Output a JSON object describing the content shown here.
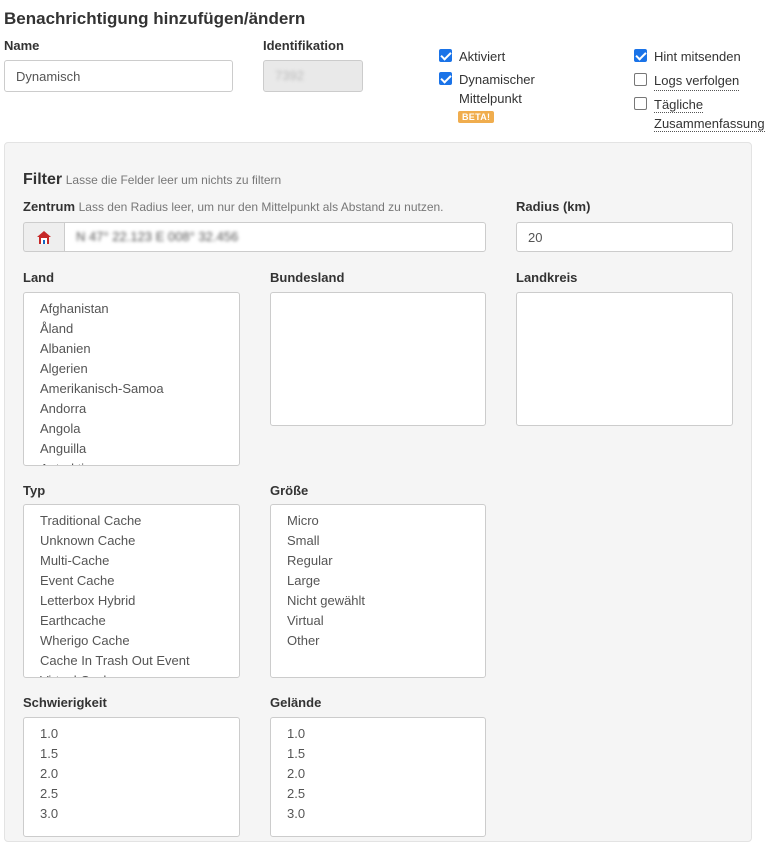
{
  "page_title": "Benachrichtigung hinzufügen/ändern",
  "name_field": {
    "label": "Name",
    "value": "Dynamisch"
  },
  "id_field": {
    "label": "Identifikation",
    "value": "7392"
  },
  "checkboxes": {
    "aktiviert": {
      "label": "Aktiviert",
      "checked": true
    },
    "dynamischer": {
      "label_line1": "Dynamischer",
      "label_line2": "Mittelpunkt",
      "checked": true,
      "badge": "BETA!"
    },
    "hint": {
      "label": "Hint mitsenden",
      "checked": true
    },
    "logs": {
      "label": "Logs verfolgen",
      "checked": false
    },
    "taegliche": {
      "label_line1": "Tägliche",
      "label_line2": "Zusammenfassung",
      "checked": false
    }
  },
  "filter": {
    "title": "Filter",
    "hint": "Lasse die Felder leer um nichts zu filtern",
    "zentrum": {
      "label": "Zentrum",
      "hint": "Lass den Radius leer, um nur den Mittelpunkt als Abstand zu nutzen.",
      "value": "N 47° 22.123 E 008° 32.456",
      "icon": "home-icon"
    },
    "radius": {
      "label": "Radius (km)",
      "value": "20"
    },
    "land": {
      "label": "Land",
      "options": [
        "Afghanistan",
        "Åland",
        "Albanien",
        "Algerien",
        "Amerikanisch-Samoa",
        "Andorra",
        "Angola",
        "Anguilla",
        "Antarktis"
      ]
    },
    "bundesland": {
      "label": "Bundesland",
      "options": []
    },
    "landkreis": {
      "label": "Landkreis",
      "options": []
    },
    "typ": {
      "label": "Typ",
      "options": [
        "Traditional Cache",
        "Unknown Cache",
        "Multi-Cache",
        "Event Cache",
        "Letterbox Hybrid",
        "Earthcache",
        "Wherigo Cache",
        "Cache In Trash Out Event",
        "Virtual Cache"
      ]
    },
    "groesse": {
      "label": "Größe",
      "options": [
        "Micro",
        "Small",
        "Regular",
        "Large",
        "Nicht gewählt",
        "Virtual",
        "Other"
      ]
    },
    "schwierigkeit": {
      "label": "Schwierigkeit",
      "options": [
        "1.0",
        "1.5",
        "2.0",
        "2.5",
        "3.0"
      ]
    },
    "gelaende": {
      "label": "Gelände",
      "options": [
        "1.0",
        "1.5",
        "2.0",
        "2.5",
        "3.0"
      ]
    }
  }
}
